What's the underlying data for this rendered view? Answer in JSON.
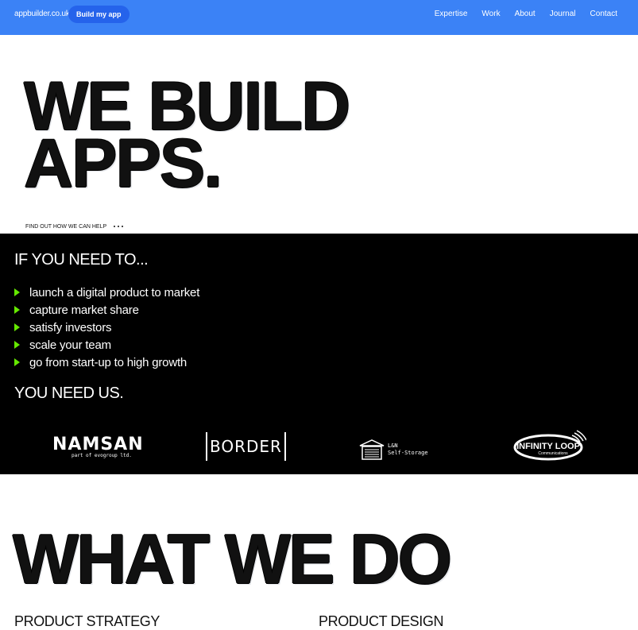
{
  "header": {
    "brand": "appbuilder.co.uk",
    "cta_label": "Build my app",
    "nav": [
      "Expertise",
      "Work",
      "About",
      "Journal",
      "Contact"
    ]
  },
  "hero": {
    "title_line1": "WE BUILD",
    "title_line2": "APPS.",
    "findout": "FIND OUT HOW WE CAN HELP"
  },
  "band": {
    "heading": "IF YOU NEED TO...",
    "bullets": [
      "launch a digital product to market",
      "capture market share",
      "satisfy investors",
      "scale your team",
      "go from start-up to high growth"
    ],
    "closing": "YOU NEED US.",
    "logos": {
      "namsan": "NAMSAN",
      "namsan_sub": "part of evogroup ltd.",
      "border": "BORDER",
      "ln_line1": "L&N",
      "ln_line2": "Self-Storage",
      "infinity_line1": "INFINITY LOOP",
      "infinity_line2": "Communications"
    }
  },
  "what_we_do": {
    "title": "WHAT WE DO",
    "services": [
      "PRODUCT STRATEGY",
      "PRODUCT DESIGN"
    ]
  },
  "colors": {
    "header_bg": "#3b82f6",
    "cta_bg": "#2563eb",
    "bullet_arrow": "#65e800",
    "band_bg": "#000000"
  }
}
